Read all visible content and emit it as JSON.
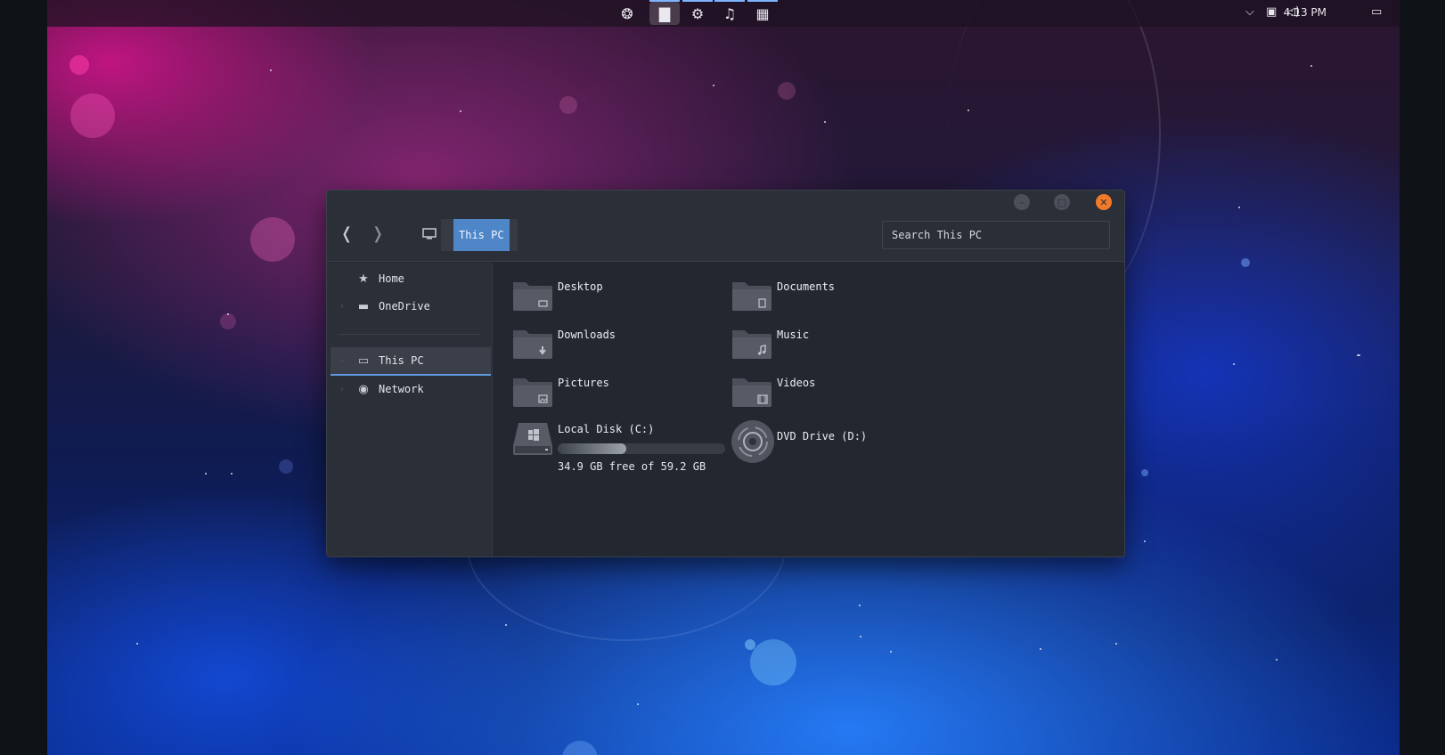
{
  "taskbar": {
    "apps": [
      {
        "name": "ubuntu-icon",
        "glyph": "❂"
      },
      {
        "name": "files-icon",
        "glyph": "▇",
        "active": true
      },
      {
        "name": "settings-icon",
        "glyph": "⚙"
      },
      {
        "name": "music-icon",
        "glyph": "♫"
      },
      {
        "name": "mixer-icon",
        "glyph": "▦"
      }
    ],
    "clock": "4:13 PM",
    "tray": {
      "chevron": "⌵",
      "network": "▣",
      "volume": "◁)",
      "notifications": "▭"
    }
  },
  "window": {
    "controls": {
      "minimize": "–",
      "maximize": "▢",
      "close": "✕"
    },
    "nav": {
      "back": "❬",
      "forward": "❭"
    },
    "breadcrumb": "This PC",
    "search_placeholder": "Search This PC"
  },
  "sidebar": {
    "items": [
      {
        "label": "Home",
        "icon": "★",
        "chevron": ""
      },
      {
        "label": "OneDrive",
        "icon": "▬",
        "chevron": "›"
      },
      {
        "label": "This PC",
        "icon": "▭",
        "chevron": "›",
        "active": true
      },
      {
        "label": "Network",
        "icon": "◉",
        "chevron": "›"
      }
    ]
  },
  "content": {
    "folders": [
      {
        "label": "Desktop",
        "badge": "▭"
      },
      {
        "label": "Documents",
        "badge": "▤"
      },
      {
        "label": "Downloads",
        "badge": "⬇"
      },
      {
        "label": "Music",
        "badge": "♫"
      },
      {
        "label": "Pictures",
        "badge": "▨"
      },
      {
        "label": "Videos",
        "badge": "▦"
      }
    ],
    "drives": [
      {
        "label": "Local Disk (C:)",
        "free_text": "34.9 GB free of 59.2 GB",
        "used_fraction": 0.41
      },
      {
        "label": "DVD Drive (D:)"
      }
    ]
  },
  "colors": {
    "accent": "#4e86c8",
    "close": "#f07a2a",
    "window_bg": "#232730"
  }
}
